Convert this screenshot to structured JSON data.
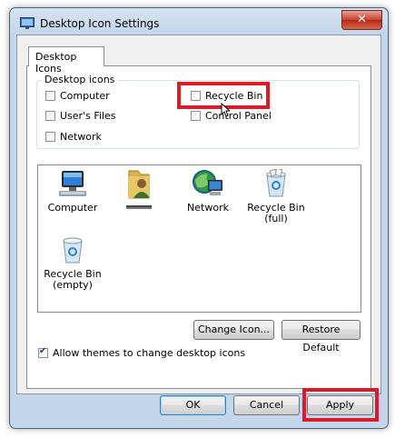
{
  "window": {
    "title": "Desktop Icon Settings",
    "close_label": "✕"
  },
  "tabs": [
    {
      "label": "Desktop Icons"
    }
  ],
  "desktop_icons_group": {
    "label": "Desktop icons",
    "checkboxes": [
      {
        "label": "Computer",
        "checked": false
      },
      {
        "label": "User's Files",
        "checked": false
      },
      {
        "label": "Network",
        "checked": false
      },
      {
        "label": "Recycle Bin",
        "checked": false
      },
      {
        "label": "Control Panel",
        "checked": false
      }
    ]
  },
  "icon_list": [
    {
      "caption": "Computer",
      "icon": "computer-icon"
    },
    {
      "caption": "",
      "icon": "user-files-icon"
    },
    {
      "caption": "Network",
      "icon": "network-icon"
    },
    {
      "caption": "Recycle Bin (full)",
      "line1": "Recycle Bin",
      "line2": "(full)",
      "icon": "recycle-bin-full-icon"
    },
    {
      "caption": "Recycle Bin (empty)",
      "line1": "Recycle Bin",
      "line2": "(empty)",
      "icon": "recycle-bin-empty-icon"
    }
  ],
  "buttons": {
    "change_icon": "Change Icon...",
    "restore_default": "Restore Default",
    "ok": "OK",
    "cancel": "Cancel",
    "apply": "Apply"
  },
  "allow_themes": {
    "label": "Allow themes to change desktop icons",
    "checked": true
  },
  "colors": {
    "annotation": "#d81c2a",
    "window_frame": "#c4d6ea",
    "close_button": "#c7412f"
  }
}
